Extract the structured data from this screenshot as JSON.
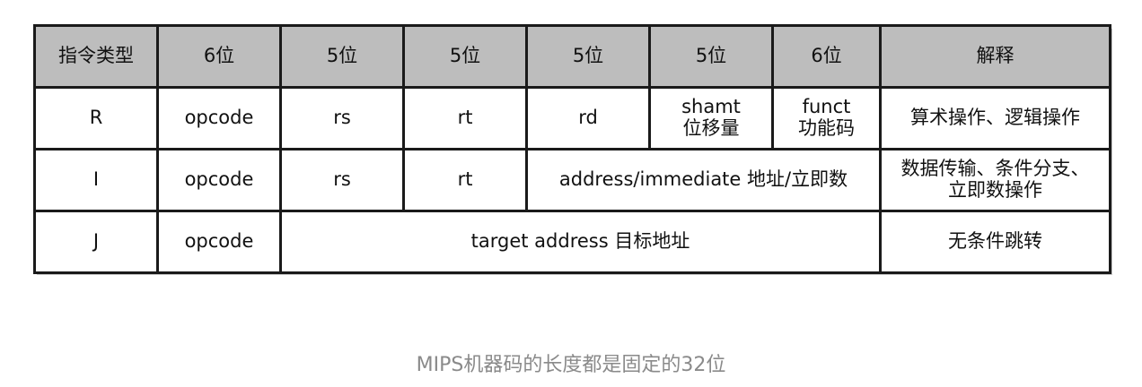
{
  "table": {
    "headers": [
      "指令类型",
      "6位",
      "5位",
      "5位",
      "5位",
      "5位",
      "6位",
      "解释"
    ],
    "rows": {
      "r": {
        "type": "R",
        "opcode": "opcode",
        "rs": "rs",
        "rt": "rt",
        "rd": "rd",
        "shamt": [
          "shamt",
          "位移量"
        ],
        "funct": [
          "funct",
          "功能码"
        ],
        "desc": "算术操作、逻辑操作"
      },
      "i": {
        "type": "I",
        "opcode": "opcode",
        "rs": "rs",
        "rt": "rt",
        "imm": "address/immediate 地址/立即数",
        "desc": [
          "数据传输、条件分支、",
          "立即数操作"
        ]
      },
      "j": {
        "type": "J",
        "opcode": "opcode",
        "target": "target address 目标地址",
        "desc": "无条件跳转"
      }
    }
  },
  "caption": "MIPS机器码的长度都是固定的32位"
}
